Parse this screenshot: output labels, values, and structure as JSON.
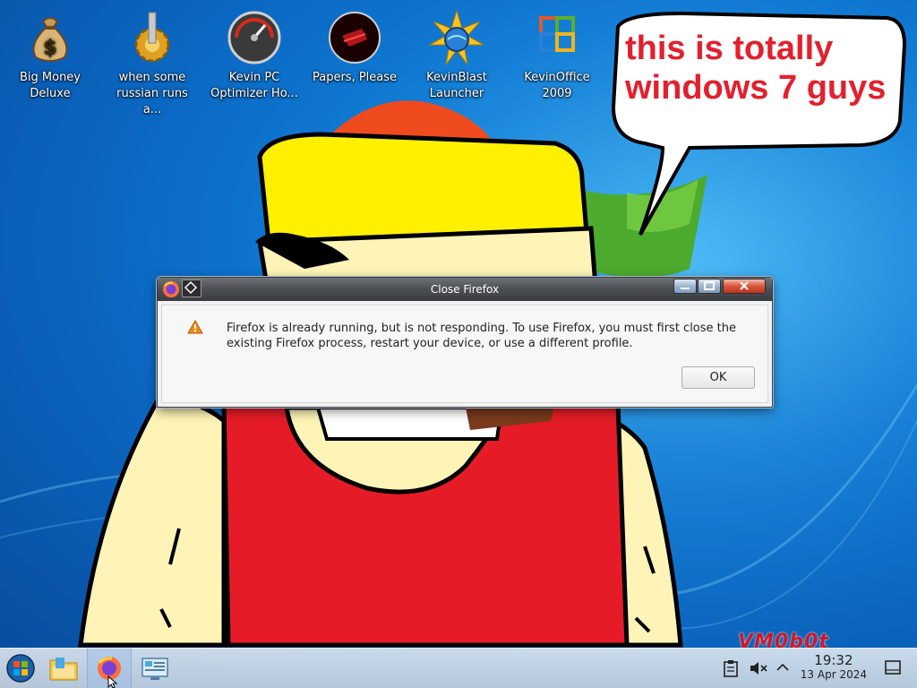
{
  "desktop": {
    "icons": [
      {
        "label": "Big Money Deluxe",
        "icon": "money-bag-icon"
      },
      {
        "label": "when some russian runs a...",
        "icon": "gear-trophy-icon"
      },
      {
        "label": "Kevin PC Optimizer Ho...",
        "icon": "speedometer-icon"
      },
      {
        "label": "Papers, Please",
        "icon": "papers-please-icon"
      },
      {
        "label": "KevinBlast Launcher",
        "icon": "starburst-globe-icon"
      },
      {
        "label": "KevinOffice 2009",
        "icon": "office-logo-icon"
      }
    ],
    "speech_bubble": "this is totally windows 7 guys",
    "watermark": "VM0b0t"
  },
  "dialog": {
    "title": "Close Firefox",
    "message": "Firefox is already running, but is not responding. To use Firefox, you must first close the existing Firefox process, restart your device, or use a different profile.",
    "ok_label": "OK"
  },
  "taskbar": {
    "items": [
      "start-orb-icon",
      "file-manager-icon",
      "firefox-icon",
      "system-settings-icon"
    ],
    "tray": [
      "clipboard-icon",
      "volume-muted-icon",
      "chevron-up-icon"
    ],
    "time": "19:32",
    "date": "13 Apr 2024"
  },
  "colors": {
    "accent_red": "#e3202e",
    "taskbar": "#dde5ee"
  }
}
